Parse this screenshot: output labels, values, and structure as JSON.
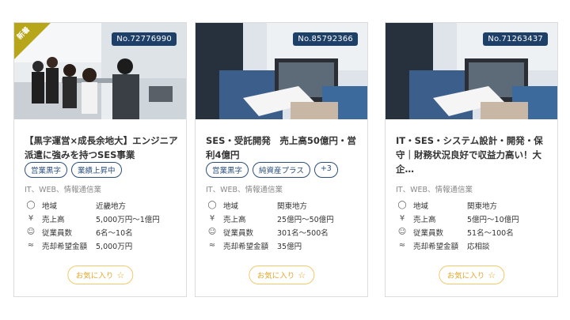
{
  "cards": [
    {
      "number": "No.72776990",
      "new_label": "新着",
      "title": "【黒字運営×成長余地大】エンジニア派遣に強みを持つSES事業",
      "tags": [
        "営業黒字",
        "業績上昇中"
      ],
      "industry": "IT、WEB、情報通信業",
      "rows": [
        {
          "icon": "location-pin-icon",
          "label": "地域",
          "value": "近畿地方"
        },
        {
          "icon": "yen-icon",
          "label": "売上高",
          "value": "5,000万円～1億円"
        },
        {
          "icon": "person-icon",
          "label": "従業員数",
          "value": "6名～10名"
        },
        {
          "icon": "handshake-icon",
          "label": "売却希望金額",
          "value": "5,000万円"
        }
      ],
      "fav_label": "お気に入り"
    },
    {
      "number": "No.85792366",
      "title": "SES・受託開発　売上高50億円・営利4億円",
      "tags": [
        "営業黒字",
        "純資産プラス",
        "+3"
      ],
      "industry": "IT、WEB、情報通信業",
      "rows": [
        {
          "icon": "location-pin-icon",
          "label": "地域",
          "value": "関東地方"
        },
        {
          "icon": "yen-icon",
          "label": "売上高",
          "value": "25億円～50億円"
        },
        {
          "icon": "person-icon",
          "label": "従業員数",
          "value": "301名～500名"
        },
        {
          "icon": "handshake-icon",
          "label": "売却希望金額",
          "value": "35億円"
        }
      ],
      "fav_label": "お気に入り"
    },
    {
      "number": "No.71263437",
      "title": "IT・SES・システム設計・開発・保守｜財務状況良好で収益力高い！大企…",
      "tags": [],
      "industry": "IT、WEB、情報通信業",
      "rows": [
        {
          "icon": "location-pin-icon",
          "label": "地域",
          "value": "関東地方"
        },
        {
          "icon": "yen-icon",
          "label": "売上高",
          "value": "5億円～10億円"
        },
        {
          "icon": "person-icon",
          "label": "従業員数",
          "value": "51名～100名"
        },
        {
          "icon": "handshake-icon",
          "label": "売却希望金額",
          "value": "応相談"
        }
      ],
      "fav_label": "お気に入り"
    }
  ]
}
